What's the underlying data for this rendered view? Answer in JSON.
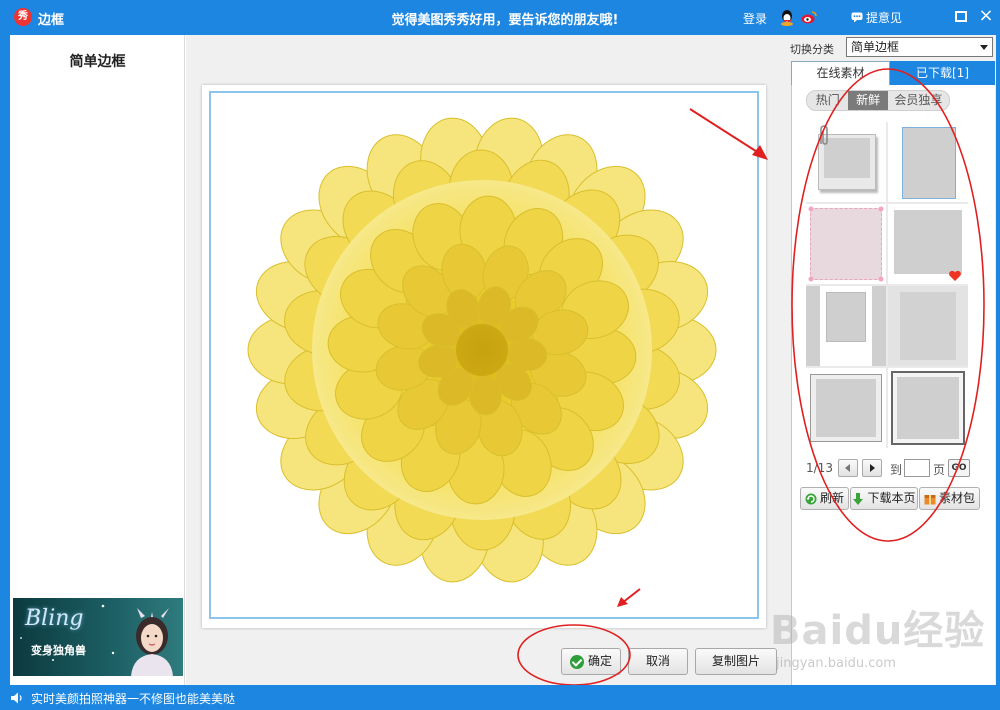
{
  "window": {
    "title": "边框",
    "app_logo_char": "秀",
    "slogan": "觉得美图秀秀好用，要告诉您的朋友哦!",
    "login_label": "登录",
    "feedback_label": "提意见",
    "close_glyph": "×",
    "accent_color": "#1c86e0"
  },
  "left_panel": {
    "heading": "简单边框",
    "promo": {
      "word": "Bling",
      "text": "变身独角兽"
    }
  },
  "buttons": {
    "ok_label": "确定",
    "cancel_label": "取消",
    "copy_label": "复制图片"
  },
  "right_panel": {
    "category_label": "切换分类",
    "category_value": "简单边框",
    "tabs": {
      "online": "在线素材",
      "downloaded": "已下载[1]"
    },
    "filters": [
      "热门",
      "新鲜",
      "会员独享"
    ],
    "active_filter": "新鲜",
    "pager": {
      "indicator": "1/13",
      "to_label": "到",
      "unit_label": "页",
      "go_label": "GO"
    },
    "actions": {
      "refresh": "刷新",
      "download_page": "下载本页",
      "material_pack": "素材包"
    }
  },
  "statusbar": {
    "text": "实时美颜拍照神器一不修图也能美美哒"
  },
  "watermark": {
    "logo": "Baidu经验",
    "url": "jingyan.baidu.com"
  }
}
